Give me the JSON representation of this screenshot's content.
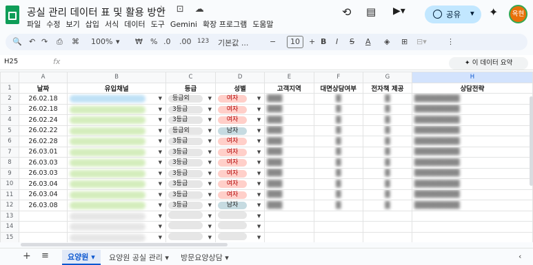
{
  "doc": {
    "title": "공실 관리 데이터 표 및 활용 방안"
  },
  "menu": [
    "파일",
    "수정",
    "보기",
    "삽입",
    "서식",
    "데이터",
    "도구",
    "Gemini",
    "확장 프로그램",
    "도움말"
  ],
  "header": {
    "share_label": "공유",
    "avatar_text": "옥현",
    "share_color": "#c2e7ff"
  },
  "toolbar": {
    "zoom": "100%",
    "currency": "₩",
    "percent": "%",
    "dec_less": ".0",
    "dec_more": ".00",
    "number_fmt": "123",
    "font": "기본값 ...",
    "font_size": "10"
  },
  "formula": {
    "cell_ref": "H25",
    "fx": "fx"
  },
  "ai": {
    "label": "✦ 이 데이터 요약"
  },
  "columns": [
    "A",
    "B",
    "C",
    "D",
    "E",
    "F",
    "G",
    "H"
  ],
  "headers": {
    "a": "날짜",
    "b": "유입채널",
    "c": "등급",
    "d": "성별",
    "e": "고객지역",
    "f": "대면상담여부",
    "g": "전자책 제공",
    "h": "상담전략"
  },
  "rows": [
    {
      "n": "1"
    },
    {
      "n": "2",
      "date": "26.02.18",
      "grade": "등급외",
      "gender": "여자"
    },
    {
      "n": "3",
      "date": "26.02.18",
      "grade": "3등급",
      "gender": "여자"
    },
    {
      "n": "4",
      "date": "26.02.24",
      "grade": "3등급",
      "gender": "여자"
    },
    {
      "n": "5",
      "date": "26.02.22",
      "grade": "등급외",
      "gender": "남자"
    },
    {
      "n": "6",
      "date": "26.02.28",
      "grade": "3등급",
      "gender": "여자"
    },
    {
      "n": "7",
      "date": "26.03.01",
      "grade": "3등급",
      "gender": "여자"
    },
    {
      "n": "8",
      "date": "26.03.03",
      "grade": "3등급",
      "gender": "여자"
    },
    {
      "n": "9",
      "date": "26.03.03",
      "grade": "3등급",
      "gender": "여자"
    },
    {
      "n": "10",
      "date": "26.03.04",
      "grade": "3등급",
      "gender": "여자"
    },
    {
      "n": "11",
      "date": "26.03.04",
      "grade": "3등급",
      "gender": "여자"
    },
    {
      "n": "12",
      "date": "26.03.08",
      "grade": "3등급",
      "gender": "남자"
    },
    {
      "n": "13"
    },
    {
      "n": "14"
    },
    {
      "n": "15"
    }
  ],
  "tabs": [
    "요양원",
    "요양원 공실 관리",
    "방문요양상담"
  ]
}
